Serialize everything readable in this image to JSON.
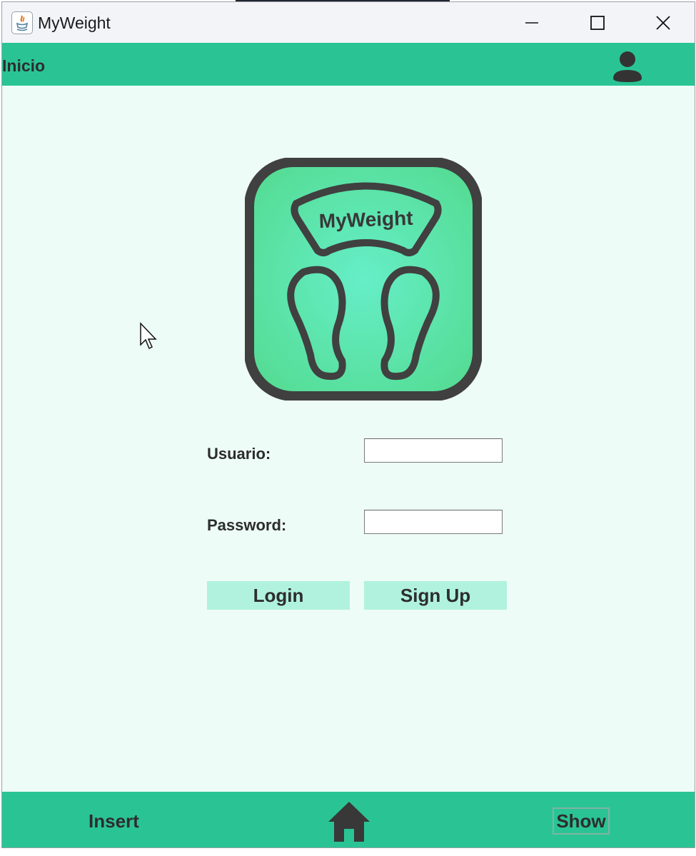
{
  "window": {
    "title": "MyWeight"
  },
  "header": {
    "title": "Inicio",
    "icon": "user-icon"
  },
  "logo": {
    "text": "MyWeight",
    "icon": "bathroom-scale-icon"
  },
  "form": {
    "username_label": "Usuario:",
    "username_value": "",
    "password_label": "Password:",
    "password_value": "",
    "login_label": "Login",
    "signup_label": "Sign Up"
  },
  "footer": {
    "insert_label": "Insert",
    "home_icon": "home-icon",
    "show_label": "Show"
  },
  "colors": {
    "accent": "#2ac494",
    "background": "#edfcf6",
    "button": "#b0f2de",
    "text": "#2d2d2d"
  }
}
